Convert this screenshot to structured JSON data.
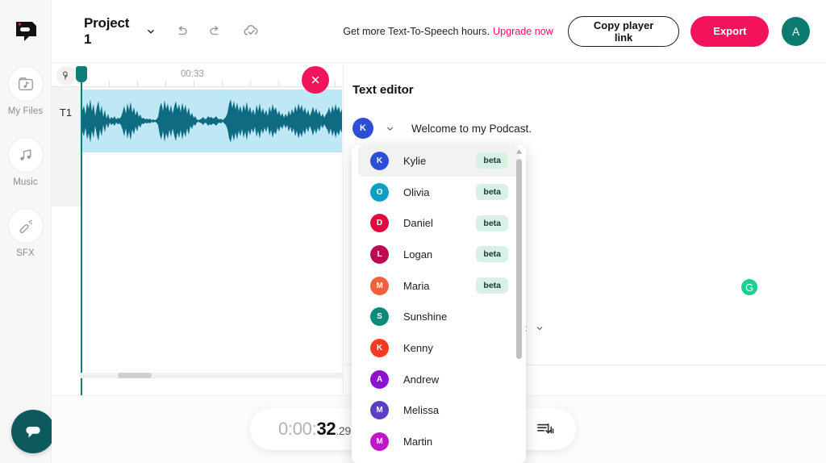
{
  "app": {
    "logo_icon": "descript-logo-icon",
    "accent_pink": "#f4145b",
    "accent_teal": "#0d7d78"
  },
  "rail": {
    "items": [
      {
        "label": "My Files",
        "icon": "folder-music-icon"
      },
      {
        "label": "Music",
        "icon": "music-notes-icon"
      },
      {
        "label": "SFX",
        "icon": "magic-wand-icon"
      }
    ],
    "chat_icon": "chat-bubble-icon"
  },
  "topbar": {
    "project_name": "Project 1",
    "project_chevron_icon": "chevron-down-icon",
    "undo_icon": "undo-arrow-icon",
    "redo_icon": "redo-arrow-icon",
    "cloud_icon": "cloud-check-icon",
    "promo_text": "Get more Text-To-Speech hours.",
    "promo_link": "Upgrade now",
    "copy_link_label": "Copy player link",
    "export_label": "Export",
    "avatar_initial": "A",
    "avatar_color": "#0b7b72"
  },
  "timeline": {
    "marker_icon": "marker-pin-icon",
    "ruler_time": "00:33",
    "track_label": "T1",
    "close_clip_icon": "close-x-icon",
    "clip_color": "#bfe8f7",
    "waveform_color": "#0f6b82",
    "playhead_color": "#0d7d78"
  },
  "zoom_control": {
    "zoom_in_label": "+",
    "zoom_out_label": "−",
    "zoom_in_icon": "plus-circle-icon",
    "zoom_out_icon": "minus-circle-icon"
  },
  "panel": {
    "title": "Text editor",
    "speaker_initial": "K",
    "speaker_color": "#2d4fd6",
    "speaker_chevron_icon": "chevron-down-icon",
    "script_text": "Welcome to my Podcast.",
    "grammarly_label": "G",
    "grammarly_color": "#15d38e",
    "import_label": "ort",
    "import_chevron_icon": "chevron-down-icon"
  },
  "dropdown": {
    "scroll_up_icon": "scroll-up-arrow-icon",
    "items": [
      {
        "name": "Kylie",
        "initial": "K",
        "color": "#2d4fd6",
        "badge": "beta",
        "selected": true
      },
      {
        "name": "Olivia",
        "initial": "O",
        "color": "#0c9fc4",
        "badge": "beta",
        "selected": false
      },
      {
        "name": "Daniel",
        "initial": "D",
        "color": "#e4093f",
        "badge": "beta",
        "selected": false
      },
      {
        "name": "Logan",
        "initial": "L",
        "color": "#bd0a53",
        "badge": "beta",
        "selected": false
      },
      {
        "name": "Maria",
        "initial": "M",
        "color": "#f2603c",
        "badge": "beta",
        "selected": false
      },
      {
        "name": "Sunshine",
        "initial": "S",
        "color": "#0d8a7a",
        "badge": "",
        "selected": false
      },
      {
        "name": "Kenny",
        "initial": "K",
        "color": "#f53a20",
        "badge": "",
        "selected": false
      },
      {
        "name": "Andrew",
        "initial": "A",
        "color": "#8a14cf",
        "badge": "",
        "selected": false
      },
      {
        "name": "Melissa",
        "initial": "M",
        "color": "#5b3ec4",
        "badge": "",
        "selected": false
      },
      {
        "name": "Martin",
        "initial": "M",
        "color": "#c016c8",
        "badge": "",
        "selected": false
      }
    ]
  },
  "player": {
    "time_hours_min": "0:00:",
    "time_seconds": "32",
    "time_millis": ".29",
    "mix_icon": "audio-mix-icon"
  }
}
